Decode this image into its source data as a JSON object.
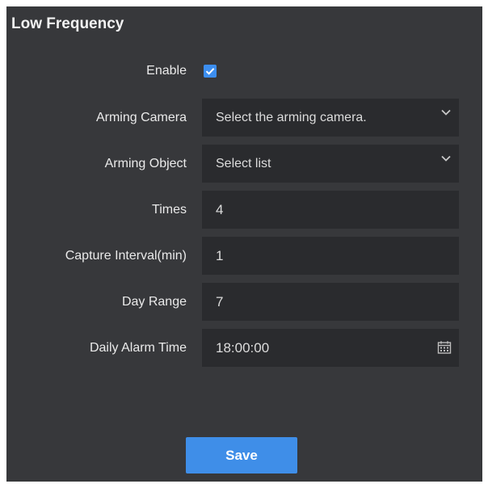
{
  "panel": {
    "title": "Low Frequency"
  },
  "form": {
    "enable": {
      "label": "Enable",
      "checked": true
    },
    "arming_camera": {
      "label": "Arming Camera",
      "placeholder": "Select the arming camera."
    },
    "arming_object": {
      "label": "Arming Object",
      "placeholder": "Select list"
    },
    "times": {
      "label": "Times",
      "value": "4"
    },
    "capture_interval": {
      "label": "Capture Interval(min)",
      "value": "1"
    },
    "day_range": {
      "label": "Day Range",
      "value": "7"
    },
    "daily_alarm_time": {
      "label": "Daily Alarm Time",
      "value": "18:00:00"
    }
  },
  "actions": {
    "save_label": "Save"
  },
  "icons": {
    "enable_checkbox": "checkmark-icon",
    "dropdown": "chevron-down-icon",
    "time_picker": "calendar-icon"
  },
  "colors": {
    "panel_bg": "#37383b",
    "field_bg": "#2a2b2e",
    "accent": "#3f8ee8"
  }
}
